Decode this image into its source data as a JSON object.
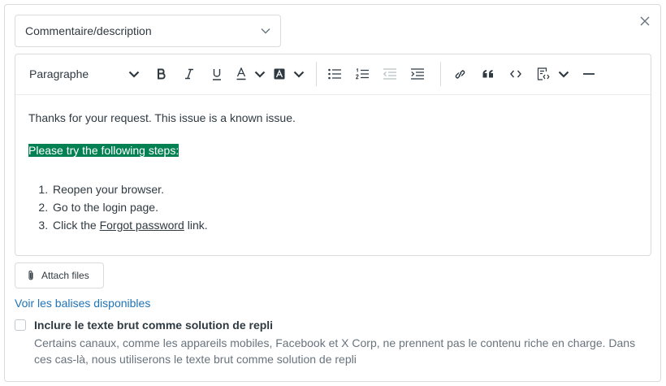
{
  "select": {
    "value": "Commentaire/description"
  },
  "toolbar": {
    "paragraph_label": "Paragraphe"
  },
  "editor": {
    "line1": "Thanks for your request.  This issue is a known issue.",
    "highlight": "Please try the following steps:",
    "steps": {
      "s1": "Reopen your browser.",
      "s2": "Go to the login page.",
      "s3_prefix": "Click the ",
      "s3_link": "Forgot password",
      "s3_suffix": " link."
    }
  },
  "attach": {
    "label": "Attach files"
  },
  "placeholders_link": "Voir les balises disponibles",
  "fallback": {
    "label": "Inclure le texte brut comme solution de repli",
    "hint": "Certains canaux, comme les appareils mobiles, Facebook et X Corp, ne prennent pas le contenu riche en charge. Dans ces cas-là, nous utiliserons le texte brut comme solution de repli"
  },
  "colors": {
    "highlight": "#038153",
    "link": "#1f73b7",
    "border": "#d8dcde"
  },
  "icons": [
    "close-icon",
    "chevron-down-icon",
    "bold-icon",
    "italic-icon",
    "underline-icon",
    "text-color-icon",
    "background-color-icon",
    "bulleted-list-icon",
    "numbered-list-icon",
    "outdent-icon",
    "indent-icon",
    "link-icon",
    "quote-icon",
    "code-icon",
    "code-block-icon",
    "horizontal-rule-icon",
    "paperclip-icon"
  ]
}
